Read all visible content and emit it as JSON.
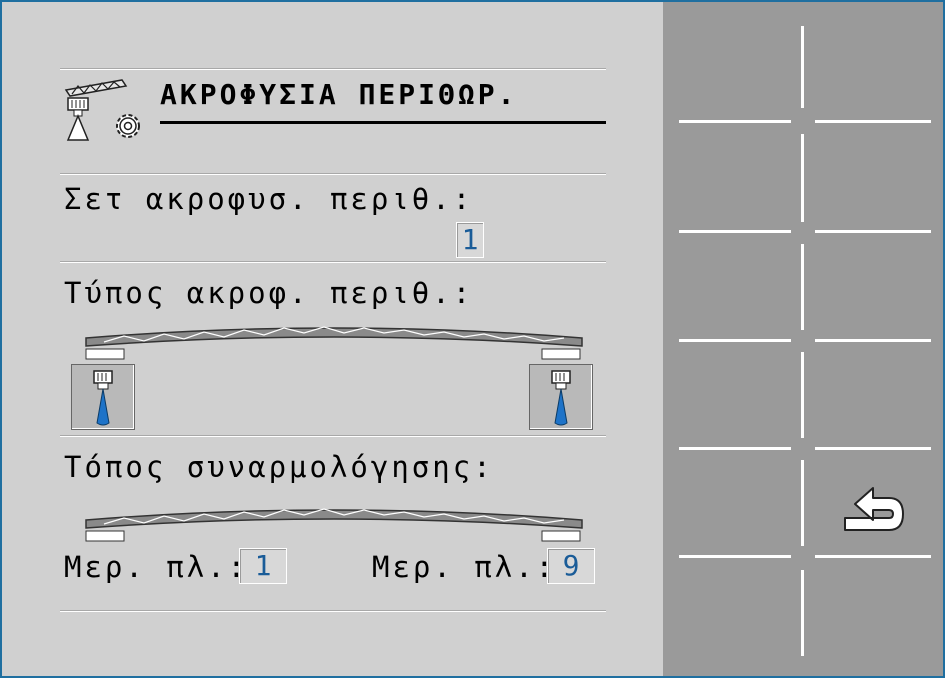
{
  "header": {
    "title": "ΑΚΡΟΦΥΣΙΑ ΠΕΡΙΘΩΡ."
  },
  "edge_nozzle_set": {
    "label": "Σετ ακροφυσ. περιθ.:",
    "value": "1"
  },
  "edge_nozzle_type": {
    "label": "Τύπος ακροφ. περιθ.:"
  },
  "mounting_position": {
    "label": "Τόπος συναρμολόγησης:",
    "left": {
      "label": "Μερ. πλ.:",
      "value": "1"
    },
    "right": {
      "label": "Μερ. πλ.:",
      "value": "9"
    }
  },
  "softkeys": {
    "back_icon": "undo-arrow-icon"
  },
  "colors": {
    "value_text": "#1a5c98",
    "nozzle_spray": "#1e73c8",
    "frame_border": "#1f6fa0",
    "softkey_bg": "#9a9a9a"
  }
}
